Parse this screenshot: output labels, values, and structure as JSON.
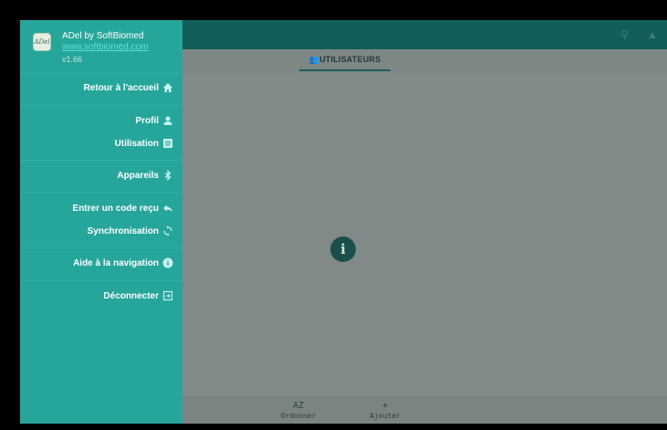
{
  "drawer": {
    "app_name": "ADel by SoftBiomed",
    "app_link": "www.softbiomed.com",
    "version": "v1.66",
    "logo_text": "ADel",
    "items": [
      {
        "label": "Retour à l'accueil",
        "icon": "home-icon"
      },
      {
        "label": "Profil",
        "icon": "person-icon"
      },
      {
        "label": "Utilisation",
        "icon": "list-icon"
      },
      {
        "label": "Appareils",
        "icon": "bluetooth-icon"
      },
      {
        "label": "Entrer un code reçu",
        "icon": "reply-icon"
      },
      {
        "label": "Synchronisation",
        "icon": "sync-icon"
      },
      {
        "label": "Aide à la navigation",
        "icon": "info-icon"
      },
      {
        "label": "Déconnecter",
        "icon": "logout-icon"
      }
    ]
  },
  "main": {
    "tab_label": "UTILISATEURS",
    "info_glyph": "i"
  },
  "bottom": {
    "sort_glyph": "AZ",
    "sort_label": "Ordonner",
    "add_glyph": "+",
    "add_label": "Ajouter"
  },
  "colors": {
    "drawer": "#26a69a",
    "appbar": "#125f59",
    "scrim": "#828a89"
  }
}
